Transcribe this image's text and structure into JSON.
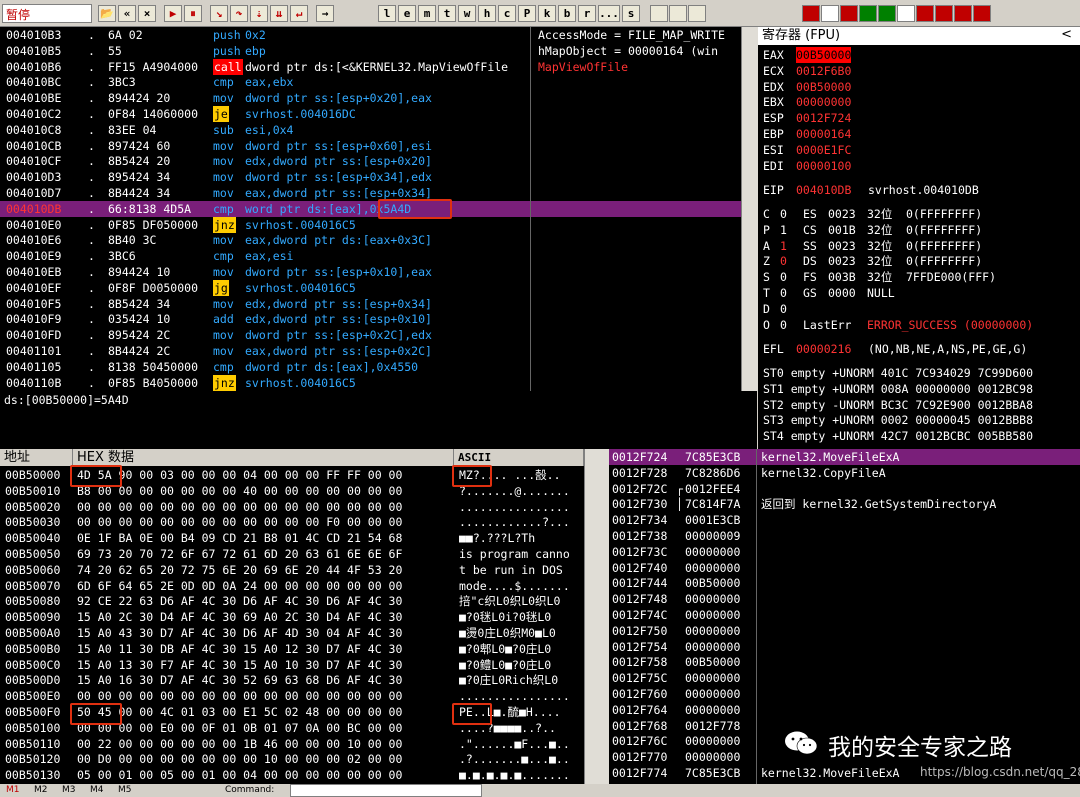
{
  "toolbar": {
    "status": "暂停",
    "buttons": [
      {
        "label": "📂",
        "icon": "open-icon"
      },
      {
        "label": "«",
        "icon": "restart-icon"
      },
      {
        "label": "×",
        "icon": "close-icon"
      },
      {
        "label": "▶",
        "icon": "run-icon"
      },
      {
        "label": "⏸",
        "icon": "pause-icon"
      },
      {
        "label": "↘",
        "icon": "step-into-icon"
      },
      {
        "label": "↷",
        "icon": "step-over-icon"
      },
      {
        "label": "⇣",
        "icon": "trace-into-icon"
      },
      {
        "label": "⇊",
        "icon": "trace-over-icon"
      },
      {
        "label": "↵",
        "icon": "execute-till-return-icon"
      },
      {
        "label": "→",
        "icon": "goto-icon"
      }
    ],
    "letters": [
      "l",
      "e",
      "m",
      "t",
      "w",
      "h",
      "c",
      "P",
      "k",
      "b",
      "r",
      "...",
      "s"
    ],
    "right_icons": [
      "list-icon",
      "settings-icon",
      "help-icon",
      "view-icon",
      "a-icon",
      "record-icon",
      "target-icon",
      "grid-icon",
      "book-icon",
      "window-icon",
      "heart-icon",
      "crack-icon",
      "decode-icon"
    ]
  },
  "disasm": {
    "rows": [
      {
        "addr": "004010B3",
        "dot": ".",
        "hex": "6A 02",
        "mn": "push",
        "mncls": "mn-push",
        "op": "0x2"
      },
      {
        "addr": "004010B5",
        "dot": ".",
        "hex": "55",
        "mn": "push",
        "mncls": "mn-push",
        "op": "ebp"
      },
      {
        "addr": "004010B6",
        "dot": ".",
        "hex": "FF15 A4904000",
        "mn": "call",
        "mncls": "mn-call",
        "op": "dword ptr ds:[<&KERNEL32.MapViewOfFile"
      },
      {
        "addr": "004010BC",
        "dot": ".",
        "hex": "3BC3",
        "mn": "cmp",
        "mncls": "mn-cmp",
        "op": "eax,ebx"
      },
      {
        "addr": "004010BE",
        "dot": ".",
        "hex": "894424 20",
        "mn": "mov",
        "mncls": "mn-mov",
        "op": "dword ptr ss:[esp+0x20],eax"
      },
      {
        "addr": "004010C2",
        "dot": ".",
        "hex": "0F84 14060000",
        "mn": "je",
        "mncls": "mn-jcc",
        "op": "svrhost.004016DC"
      },
      {
        "addr": "004010C8",
        "dot": ".",
        "hex": "83EE 04",
        "mn": "sub",
        "mncls": "mn-sub",
        "op": "esi,0x4"
      },
      {
        "addr": "004010CB",
        "dot": ".",
        "hex": "897424 60",
        "mn": "mov",
        "mncls": "mn-mov",
        "op": "dword ptr ss:[esp+0x60],esi"
      },
      {
        "addr": "004010CF",
        "dot": ".",
        "hex": "8B5424 20",
        "mn": "mov",
        "mncls": "mn-mov",
        "op": "edx,dword ptr ss:[esp+0x20]"
      },
      {
        "addr": "004010D3",
        "dot": ".",
        "hex": "895424 34",
        "mn": "mov",
        "mncls": "mn-mov",
        "op": "dword ptr ss:[esp+0x34],edx"
      },
      {
        "addr": "004010D7",
        "dot": ".",
        "hex": "8B4424 34",
        "mn": "mov",
        "mncls": "mn-mov",
        "op": "eax,dword ptr ss:[esp+0x34]"
      },
      {
        "addr": "004010DB",
        "dot": ".",
        "hex": "66:8138 4D5A",
        "mn": "cmp",
        "mncls": "mn-cmp",
        "op": "word ptr ds:[eax],0x5A4D",
        "sel": true
      },
      {
        "addr": "004010E0",
        "dot": ".",
        "hex": "0F85 DF050000",
        "mn": "jnz",
        "mncls": "mn-jcc",
        "op": "svrhost.004016C5"
      },
      {
        "addr": "004010E6",
        "dot": ".",
        "hex": "8B40 3C",
        "mn": "mov",
        "mncls": "mn-mov",
        "op": "eax,dword ptr ds:[eax+0x3C]"
      },
      {
        "addr": "004010E9",
        "dot": ".",
        "hex": "3BC6",
        "mn": "cmp",
        "mncls": "mn-cmp",
        "op": "eax,esi"
      },
      {
        "addr": "004010EB",
        "dot": ".",
        "hex": "894424 10",
        "mn": "mov",
        "mncls": "mn-mov",
        "op": "dword ptr ss:[esp+0x10],eax"
      },
      {
        "addr": "004010EF",
        "dot": ".",
        "hex": "0F8F D0050000",
        "mn": "jg",
        "mncls": "mn-jcc",
        "op": "svrhost.004016C5"
      },
      {
        "addr": "004010F5",
        "dot": ".",
        "hex": "8B5424 34",
        "mn": "mov",
        "mncls": "mn-mov",
        "op": "edx,dword ptr ss:[esp+0x34]"
      },
      {
        "addr": "004010F9",
        "dot": ".",
        "hex": "035424 10",
        "mn": "add",
        "mncls": "mn-add",
        "op": "edx,dword ptr ss:[esp+0x10]"
      },
      {
        "addr": "004010FD",
        "dot": ".",
        "hex": "895424 2C",
        "mn": "mov",
        "mncls": "mn-mov",
        "op": "dword ptr ss:[esp+0x2C],edx"
      },
      {
        "addr": "00401101",
        "dot": ".",
        "hex": "8B4424 2C",
        "mn": "mov",
        "mncls": "mn-mov",
        "op": "eax,dword ptr ss:[esp+0x2C]"
      },
      {
        "addr": "00401105",
        "dot": ".",
        "hex": "8138 50450000",
        "mn": "cmp",
        "mncls": "mn-cmp",
        "op": "dword ptr ds:[eax],0x4550"
      },
      {
        "addr": "0040110B",
        "dot": ".",
        "hex": "0F85 B4050000",
        "mn": "jnz",
        "mncls": "mn-jcc",
        "op": "svrhost.004016C5"
      }
    ],
    "comments": [
      "AccessMode = FILE_MAP_WRITE",
      "hMapObject = 00000164 (win",
      "MapViewOfFile"
    ]
  },
  "info": {
    "text": "ds:[00B50000]=5A4D"
  },
  "registers": {
    "title": "寄存器 (FPU)",
    "arrow": "<",
    "general": [
      {
        "n": "EAX",
        "v": "00B50000",
        "style": "redbg"
      },
      {
        "n": "ECX",
        "v": "0012F6B0",
        "style": "red"
      },
      {
        "n": "EDX",
        "v": "00B50000",
        "style": "red"
      },
      {
        "n": "EBX",
        "v": "00000000",
        "style": "red"
      },
      {
        "n": "ESP",
        "v": "0012F724",
        "style": "red"
      },
      {
        "n": "EBP",
        "v": "00000164",
        "style": "red"
      },
      {
        "n": "ESI",
        "v": "0000E1FC",
        "style": "red"
      },
      {
        "n": "EDI",
        "v": "00000100",
        "style": "red"
      }
    ],
    "eip": {
      "n": "EIP",
      "v": "004010DB",
      "c": "svrhost.004010DB"
    },
    "flags": [
      {
        "f": "C",
        "b": "0",
        "seg": "ES",
        "sv": "0023",
        "bits": "32位",
        "rng": "0(FFFFFFFF)",
        "bred": false
      },
      {
        "f": "P",
        "b": "1",
        "seg": "CS",
        "sv": "001B",
        "bits": "32位",
        "rng": "0(FFFFFFFF)",
        "bred": false
      },
      {
        "f": "A",
        "b": "1",
        "seg": "SS",
        "sv": "0023",
        "bits": "32位",
        "rng": "0(FFFFFFFF)",
        "bred": true
      },
      {
        "f": "Z",
        "b": "0",
        "seg": "DS",
        "sv": "0023",
        "bits": "32位",
        "rng": "0(FFFFFFFF)",
        "bred": true
      },
      {
        "f": "S",
        "b": "0",
        "seg": "FS",
        "sv": "003B",
        "bits": "32位",
        "rng": "7FFDE000(FFF)",
        "bred": false
      },
      {
        "f": "T",
        "b": "0",
        "seg": "GS",
        "sv": "0000",
        "bits": "NULL",
        "rng": "",
        "bred": false
      },
      {
        "f": "D",
        "b": "0",
        "seg": "",
        "sv": "",
        "bits": "",
        "rng": "",
        "bred": false
      }
    ],
    "o_flag": {
      "f": "O",
      "b": "0",
      "label": "LastErr",
      "val": "ERROR_SUCCESS (00000000)"
    },
    "efl": {
      "n": "EFL",
      "v": "00000216",
      "c": "(NO,NB,NE,A,NS,PE,GE,G)"
    },
    "fpu": [
      "ST0 empty +UNORM 401C 7C934029 7C99D600",
      "ST1 empty +UNORM 008A 00000000 0012BC98",
      "ST2 empty -UNORM BC3C 7C92E900 0012BBA8",
      "ST3 empty +UNORM 0002 00000045 0012BBB8",
      "ST4 empty +UNORM 42C7 0012BCBC 005BB580"
    ]
  },
  "dump": {
    "col_addr": "地址",
    "col_hex": "HEX 数据",
    "col_ascii": "ASCII",
    "rows": [
      {
        "a": "00B50000",
        "h": "4D 5A 90 00 03 00 00 00 04 00 00 00 FF FF 00 00",
        "s": "MZ?....  ...嗀.."
      },
      {
        "a": "00B50010",
        "h": "B8 00 00 00 00 00 00 00 40 00 00 00 00 00 00 00",
        "s": "?.......@......."
      },
      {
        "a": "00B50020",
        "h": "00 00 00 00 00 00 00 00 00 00 00 00 00 00 00 00",
        "s": "................"
      },
      {
        "a": "00B50030",
        "h": "00 00 00 00 00 00 00 00 00 00 00 00 F0 00 00 00",
        "s": "............?..."
      },
      {
        "a": "00B50040",
        "h": "0E 1F BA 0E 00 B4 09 CD 21 B8 01 4C CD 21 54 68",
        "s": "■■?.???L?Th"
      },
      {
        "a": "00B50050",
        "h": "69 73 20 70 72 6F 67 72 61 6D 20 63 61 6E 6E 6F",
        "s": "is program canno"
      },
      {
        "a": "00B50060",
        "h": "74 20 62 65 20 72 75 6E 20 69 6E 20 44 4F 53 20",
        "s": "t be run in DOS "
      },
      {
        "a": "00B50070",
        "h": "6D 6F 64 65 2E 0D 0D 0A 24 00 00 00 00 00 00 00",
        "s": "mode....$......."
      },
      {
        "a": "00B50080",
        "h": "92 CE 22 63 D6 AF 4C 30 D6 AF 4C 30 D6 AF 4C 30",
        "s": "掊\"c织L0织L0织L0"
      },
      {
        "a": "00B50090",
        "h": "15 A0 2C 30 D4 AF 4C 30 69 A0 2C 30 D4 AF 4C 30",
        "s": "■?0毩L0i?0毩L0"
      },
      {
        "a": "00B500A0",
        "h": "15 A0 43 30 D7 AF 4C 30 D6 AF 4D 30 04 AF 4C 30",
        "s": "■燙0庄L0织M0■L0"
      },
      {
        "a": "00B500B0",
        "h": "15 A0 11 30 DB AF 4C 30 15 A0 12 30 D7 AF 4C 30",
        "s": "■?0郫L0■?0庄L0"
      },
      {
        "a": "00B500C0",
        "h": "15 A0 13 30 F7 AF 4C 30 15 A0 10 30 D7 AF 4C 30",
        "s": "■?0鳢L0■?0庄L0"
      },
      {
        "a": "00B500D0",
        "h": "15 A0 16 30 D7 AF 4C 30 52 69 63 68 D6 AF 4C 30",
        "s": "■?0庄L0Rich织L0"
      },
      {
        "a": "00B500E0",
        "h": "00 00 00 00 00 00 00 00 00 00 00 00 00 00 00 00",
        "s": "................"
      },
      {
        "a": "00B500F0",
        "h": "50 45 00 00 4C 01 03 00 E1 5C 02 48 00 00 00 00",
        "s": "PE..L■.酼■H...."
      },
      {
        "a": "00B50100",
        "h": "00 00 00 00 E0 00 0F 01 0B 01 07 0A 00 BC 00 00",
        "s": "....?■■■■..?.."
      },
      {
        "a": "00B50110",
        "h": "00 22 00 00 00 00 00 00 1B 46 00 00 00 10 00 00",
        "s": ".\"......■F...■.."
      },
      {
        "a": "00B50120",
        "h": "00 D0 00 00 00 00 00 00 00 10 00 00 00 02 00 00",
        "s": ".?.......■...■.."
      },
      {
        "a": "00B50130",
        "h": "05 00 01 00 05 00 01 00 04 00 00 00 00 00 00 00",
        "s": "■.■.■.■.■......."
      }
    ]
  },
  "stack": {
    "rows": [
      {
        "a": "0012F724",
        "v": "7C85E3CB",
        "c": "kernel32.MoveFileExA",
        "sel": true
      },
      {
        "a": "0012F728",
        "v": "7C8286D6",
        "c": "kernel32.CopyFileA",
        "sel": false
      },
      {
        "a": "0012F72C",
        "v": "0012FEE4",
        "c": "",
        "sel": false,
        "bracket": "┌"
      },
      {
        "a": "0012F730",
        "v": "7C814F7A",
        "c": "返回到 kernel32.GetSystemDirectoryA",
        "sel": false,
        "bracket": "│"
      },
      {
        "a": "0012F734",
        "v": "0001E3CB",
        "c": "",
        "sel": false
      },
      {
        "a": "0012F738",
        "v": "00000009",
        "c": "",
        "sel": false
      },
      {
        "a": "0012F73C",
        "v": "00000000",
        "c": "",
        "sel": false
      },
      {
        "a": "0012F740",
        "v": "00000000",
        "c": "",
        "sel": false
      },
      {
        "a": "0012F744",
        "v": "00B50000",
        "c": "",
        "sel": false
      },
      {
        "a": "0012F748",
        "v": "00000000",
        "c": "",
        "sel": false
      },
      {
        "a": "0012F74C",
        "v": "00000000",
        "c": "",
        "sel": false
      },
      {
        "a": "0012F750",
        "v": "00000000",
        "c": "",
        "sel": false
      },
      {
        "a": "0012F754",
        "v": "00000000",
        "c": "",
        "sel": false
      },
      {
        "a": "0012F758",
        "v": "00B50000",
        "c": "",
        "sel": false
      },
      {
        "a": "0012F75C",
        "v": "00000000",
        "c": "",
        "sel": false
      },
      {
        "a": "0012F760",
        "v": "00000000",
        "c": "",
        "sel": false
      },
      {
        "a": "0012F764",
        "v": "00000000",
        "c": "",
        "sel": false
      },
      {
        "a": "0012F768",
        "v": "0012F778",
        "c": "",
        "sel": false
      },
      {
        "a": "0012F76C",
        "v": "00000000",
        "c": "",
        "sel": false
      },
      {
        "a": "0012F770",
        "v": "00000000",
        "c": "",
        "sel": false
      },
      {
        "a": "0012F774",
        "v": "7C85E3CB",
        "c": "kernel32.MoveFileExA",
        "sel": false
      }
    ]
  },
  "bottom": {
    "m_buttons": [
      "M1",
      "M2",
      "M3",
      "M4",
      "M5"
    ],
    "command_label": "Command:"
  },
  "watermark": {
    "text": "我的安全专家之路",
    "url": "https://blog.csdn.net/qq_28205153"
  }
}
